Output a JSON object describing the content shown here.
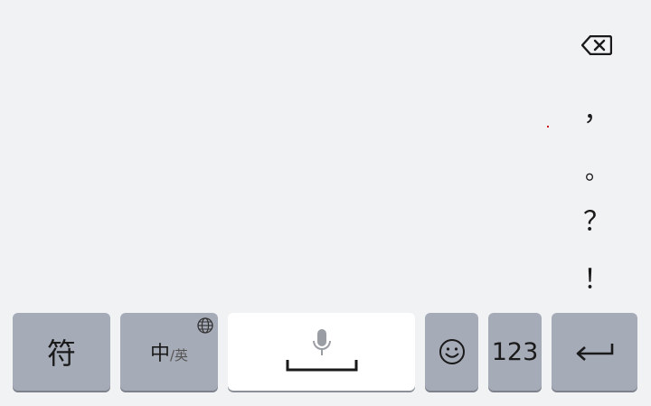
{
  "keyboard": {
    "punctuation": {
      "comma": "，",
      "period": "。",
      "question": "？",
      "exclaim": "！"
    },
    "bottom_row": {
      "symbol_label": "符",
      "lang_primary": "中",
      "lang_secondary": "/英",
      "numbers_label": "123"
    },
    "icons": {
      "backspace": "backspace-icon",
      "globe": "globe-icon",
      "microphone": "microphone-icon",
      "space": "space-bar-icon",
      "emoji": "emoji-icon",
      "enter": "enter-icon"
    },
    "colors": {
      "background": "#f1f2f4",
      "function_key": "#a6abb8",
      "space_key": "#ffffff"
    }
  }
}
